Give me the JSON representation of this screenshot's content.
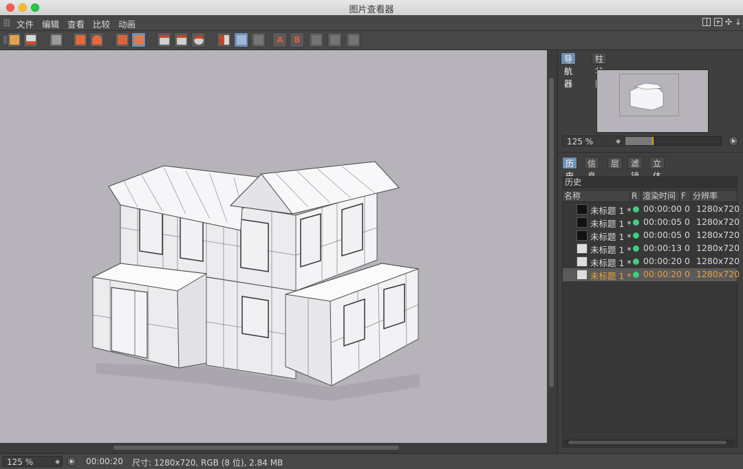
{
  "window": {
    "title": "图片查看器"
  },
  "menu": [
    "文件",
    "编辑",
    "查看",
    "比较",
    "动画"
  ],
  "colors": {
    "accent_tab": "#6f8fb3",
    "selected_text": "#e9a13a",
    "status_dot": "#3fd07b",
    "viewport_bg": "#b6b4ba"
  },
  "navigator": {
    "tabs": [
      "导航器",
      "柱状图"
    ],
    "zoom": "125 %",
    "zoom_fraction": 0.28
  },
  "history": {
    "tabs": [
      "历史",
      "信息",
      "层",
      "滤镜",
      "立体"
    ],
    "section_title": "历史",
    "columns": [
      "名称",
      "R",
      "渲染时间",
      "F",
      "分辨率"
    ],
    "rows": [
      {
        "name": "未标题 1 *",
        "time": "00:00:00",
        "f": "0",
        "res": "1280x720"
      },
      {
        "name": "未标题 1 *",
        "time": "00:00:05",
        "f": "0",
        "res": "1280x720"
      },
      {
        "name": "未标题 1 *",
        "time": "00:00:05",
        "f": "0",
        "res": "1280x720"
      },
      {
        "name": "未标题 1 *",
        "time": "00:00:13",
        "f": "0",
        "res": "1280x720"
      },
      {
        "name": "未标题 1 *",
        "time": "00:00:20",
        "f": "0",
        "res": "1280x720"
      },
      {
        "name": "未标题 1 *",
        "time": "00:00:20",
        "f": "0",
        "res": "1280x720"
      }
    ]
  },
  "status": {
    "zoom": "125 %",
    "time": "00:00:20",
    "info": "尺寸: 1280x720, RGB (8 位), 2.84 MB"
  }
}
